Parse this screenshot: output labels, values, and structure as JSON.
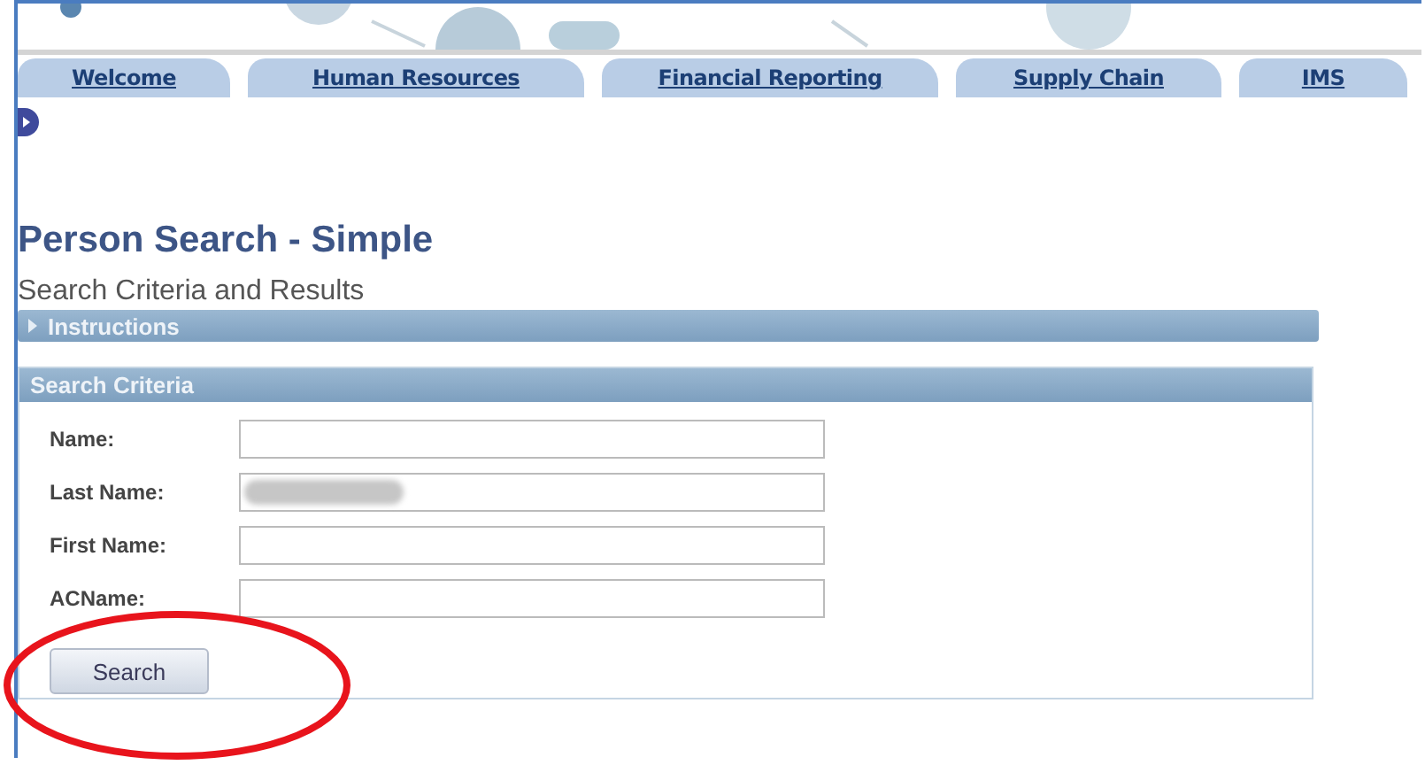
{
  "tabs": [
    {
      "label": "Welcome"
    },
    {
      "label": "Human Resources"
    },
    {
      "label": "Financial Reporting"
    },
    {
      "label": "Supply Chain"
    },
    {
      "label": "IMS"
    }
  ],
  "page": {
    "title": "Person Search - Simple",
    "subtitle": "Search Criteria and Results"
  },
  "instructions": {
    "label": "Instructions",
    "expanded": false
  },
  "search_criteria": {
    "title": "Search Criteria",
    "fields": [
      {
        "label": "Name:",
        "redacted": false
      },
      {
        "label": "Last Name:",
        "redacted": true
      },
      {
        "label": "First Name:",
        "redacted": false
      },
      {
        "label": "ACName:",
        "redacted": false
      }
    ],
    "button": "Search"
  },
  "annotation": {
    "kind": "ellipse"
  }
}
